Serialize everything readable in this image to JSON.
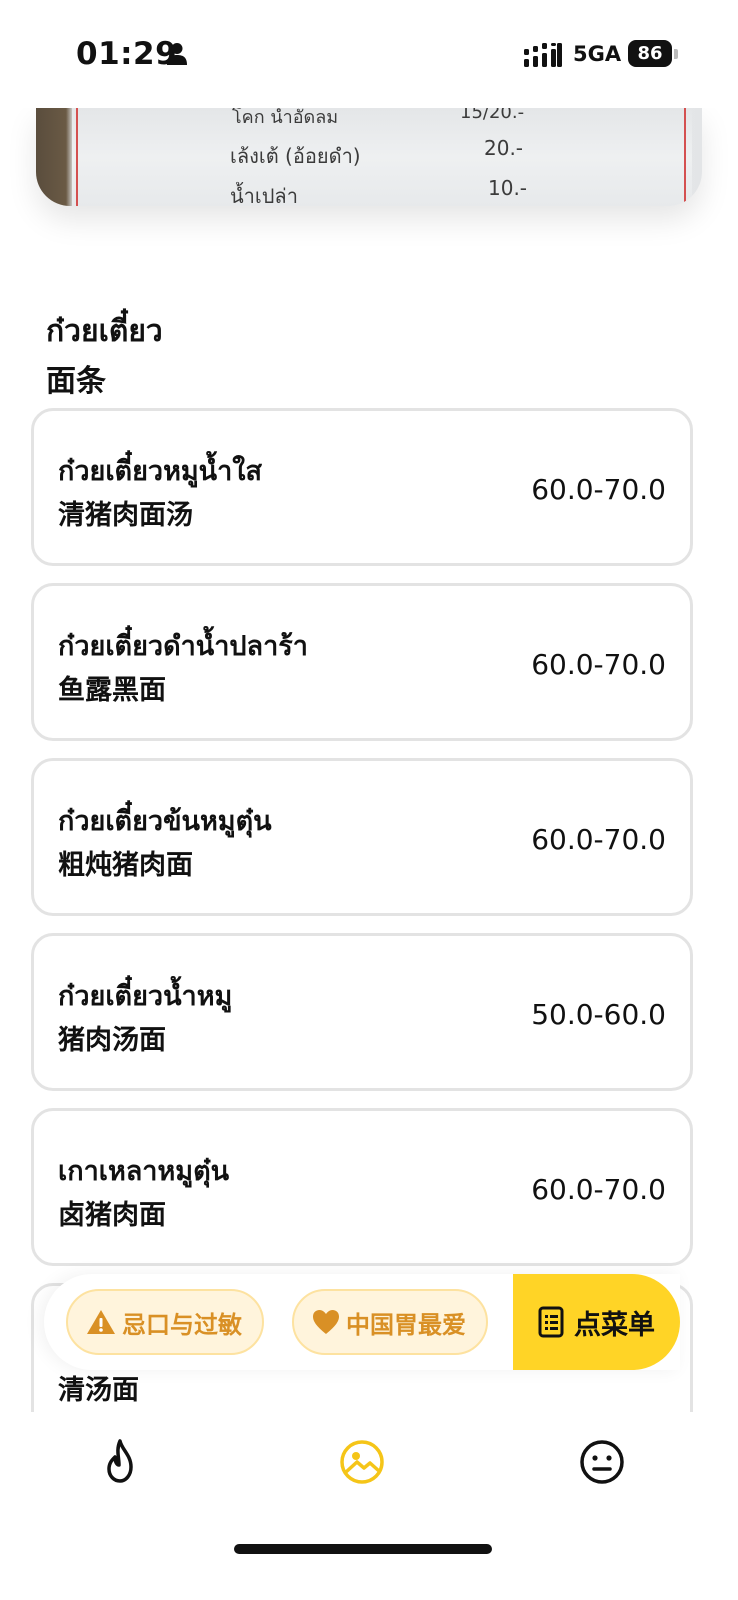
{
  "status_bar": {
    "time": "01:29",
    "network": "5GA",
    "battery": "86",
    "icons": [
      "person-icon",
      "signal-icon",
      "battery-icon"
    ]
  },
  "menu_photo": {
    "lines": [
      {
        "name": "โคก น้ำอัดลม",
        "price": "15/20.-"
      },
      {
        "name": "เล้งเต้ (อ้อยดำ)",
        "price": "20.-"
      },
      {
        "name": "น้ำเปล่า",
        "price": "10.-"
      }
    ]
  },
  "section": {
    "title_thai": "ก๋วยเตี๋ยว",
    "title_cn": "面条"
  },
  "dishes": [
    {
      "thai": "ก๋วยเตี๋ยวหมูน้ำใส",
      "cn": "清猪肉面汤",
      "price": "60.0-70.0"
    },
    {
      "thai": "ก๋วยเตี๋ยวดำน้ำปลาร้า",
      "cn": "鱼露黑面",
      "price": "60.0-70.0"
    },
    {
      "thai": "ก๋วยเตี๋ยวข้นหมูตุ๋น",
      "cn": "粗炖猪肉面",
      "price": "60.0-70.0"
    },
    {
      "thai": "ก๋วยเตี๋ยวน้ำหมู",
      "cn": "猪肉汤面",
      "price": "50.0-60.0"
    },
    {
      "thai": "เกาเหลาหมูตุ๋น",
      "cn": "卤猪肉面",
      "price": "60.0-70.0"
    },
    {
      "thai": "",
      "cn": "清汤面",
      "price": ""
    }
  ],
  "actions": {
    "allergy_label": "忌口与过敏",
    "favorite_label": "中国胃最爱",
    "order_label": "点菜单",
    "allergy_icon": "warning-icon",
    "favorite_icon": "heart-icon",
    "order_icon": "list-icon",
    "accent_color": "#ffd426",
    "chip_text_color": "#d99025"
  },
  "bottom_nav": {
    "items": [
      {
        "icon": "flame-icon",
        "active": false
      },
      {
        "icon": "image-icon",
        "active": true
      },
      {
        "icon": "face-icon",
        "active": false
      }
    ],
    "active_color": "#f5c518"
  }
}
